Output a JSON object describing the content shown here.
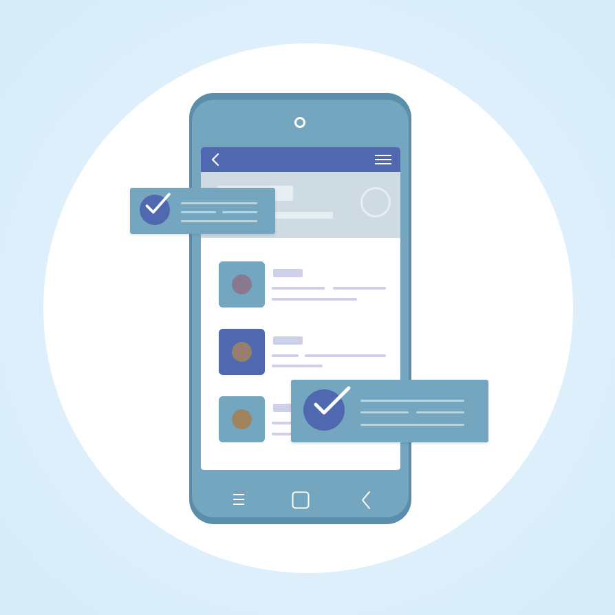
{
  "colors": {
    "background": "#dbeefa",
    "phone_frame": "#5a8eab",
    "phone_body": "#74a7bf",
    "app_bar": "#5068b0",
    "hero_panel": "#cfdbe2",
    "placeholder_bar": "#cdd0e8",
    "check_badge": "#5068b0"
  },
  "app_bar": {
    "left_icon": "back-chevron-icon",
    "right_icon": "hamburger-menu-icon"
  },
  "list_items": [
    {
      "thumb_color": "#74a7bf",
      "dot_color": "#8a7890"
    },
    {
      "thumb_color": "#5068b0",
      "dot_color": "#967f6e"
    },
    {
      "thumb_color": "#74a7bf",
      "dot_color": "#a0825e"
    }
  ],
  "nav_bar": [
    "recent-apps-icon",
    "home-icon",
    "back-icon"
  ],
  "notifications": [
    {
      "icon": "checkmark-icon",
      "status": "done"
    },
    {
      "icon": "checkmark-icon",
      "status": "done"
    }
  ]
}
